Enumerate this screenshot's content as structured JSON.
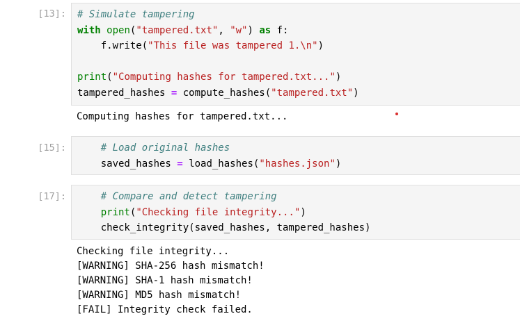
{
  "cells": [
    {
      "prompt": "[13]:",
      "code": [
        [
          {
            "t": "# Simulate tampering",
            "c": "cm"
          }
        ],
        [
          {
            "t": "with",
            "c": "kw"
          },
          {
            "t": " ",
            "c": ""
          },
          {
            "t": "open",
            "c": "bi"
          },
          {
            "t": "(",
            "c": ""
          },
          {
            "t": "\"tampered.txt\"",
            "c": "st"
          },
          {
            "t": ", ",
            "c": ""
          },
          {
            "t": "\"w\"",
            "c": "st"
          },
          {
            "t": ") ",
            "c": ""
          },
          {
            "t": "as",
            "c": "kw"
          },
          {
            "t": " f:",
            "c": ""
          }
        ],
        [
          {
            "t": "    f.write(",
            "c": ""
          },
          {
            "t": "\"This file was tampered 1.\\n\"",
            "c": "st"
          },
          {
            "t": ")",
            "c": ""
          }
        ],
        [
          {
            "t": "",
            "c": ""
          }
        ],
        [
          {
            "t": "print",
            "c": "bi"
          },
          {
            "t": "(",
            "c": ""
          },
          {
            "t": "\"Computing hashes for tampered.txt...\"",
            "c": "st"
          },
          {
            "t": ")",
            "c": ""
          }
        ],
        [
          {
            "t": "tampered_hashes ",
            "c": ""
          },
          {
            "t": "=",
            "c": "op"
          },
          {
            "t": " compute_hashes(",
            "c": ""
          },
          {
            "t": "\"tampered.txt\"",
            "c": "st"
          },
          {
            "t": ")",
            "c": ""
          }
        ]
      ],
      "output": [
        "Computing hashes for tampered.txt..."
      ]
    },
    {
      "prompt": "[15]:",
      "code": [
        [
          {
            "t": "    ",
            "c": ""
          },
          {
            "t": "# Load original hashes",
            "c": "cm"
          }
        ],
        [
          {
            "t": "    saved_hashes ",
            "c": ""
          },
          {
            "t": "=",
            "c": "op"
          },
          {
            "t": " load_hashes(",
            "c": ""
          },
          {
            "t": "\"hashes.json\"",
            "c": "st"
          },
          {
            "t": ")",
            "c": ""
          }
        ]
      ],
      "output": []
    },
    {
      "prompt": "[17]:",
      "code": [
        [
          {
            "t": "    ",
            "c": ""
          },
          {
            "t": "# Compare and detect tampering",
            "c": "cm"
          }
        ],
        [
          {
            "t": "    ",
            "c": ""
          },
          {
            "t": "print",
            "c": "bi"
          },
          {
            "t": "(",
            "c": ""
          },
          {
            "t": "\"Checking file integrity...\"",
            "c": "st"
          },
          {
            "t": ")",
            "c": ""
          }
        ],
        [
          {
            "t": "    check_integrity(saved_hashes, tampered_hashes)",
            "c": ""
          }
        ]
      ],
      "output": [
        "Checking file integrity...",
        "[WARNING] SHA-256 hash mismatch!",
        "[WARNING] SHA-1 hash mismatch!",
        "[WARNING] MD5 hash mismatch!",
        "[FAIL] Integrity check failed."
      ]
    }
  ]
}
